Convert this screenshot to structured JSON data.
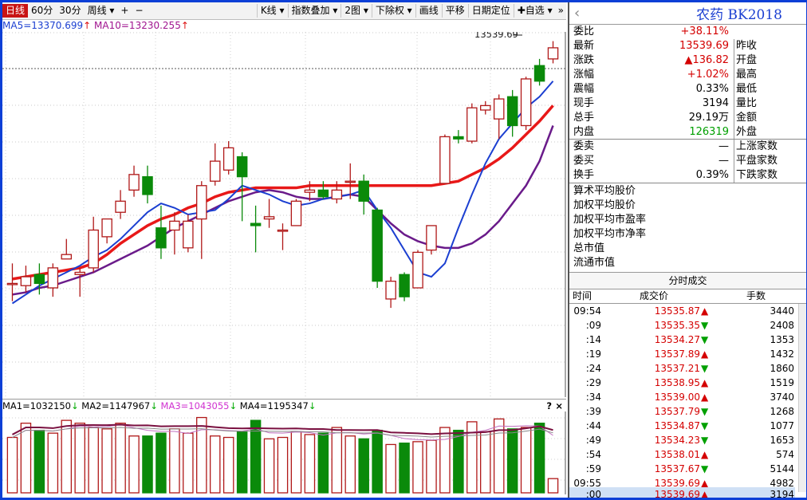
{
  "toolbar": {
    "items": [
      "日线",
      "60分",
      "30分",
      "周线 ▾",
      "+",
      "−",
      "K线 ▾",
      "指数叠加 ▾",
      "2图 ▾",
      "下除权 ▾",
      "画线",
      "平移",
      "日期定位",
      "✚自选 ▾"
    ],
    "active_index": 0,
    "right_icon": "»"
  },
  "ma": {
    "ma5": "MA5=13370.699",
    "ma10": "MA10=13230.255",
    "arrow_up": "↑",
    "colors": {
      "ma5": "#1b3fd1",
      "ma10": "#a0148f",
      "ma20": "#e81818",
      "ma60": "#6a1b8a",
      "up": "#b01818",
      "down": "#0a8a0a"
    }
  },
  "price_label": "13539.69",
  "chart_data": {
    "type": "candlestick",
    "ylim": [
      12080,
      13680
    ],
    "candles": [
      {
        "o": 12570,
        "c": 12570,
        "h": 12660,
        "l": 12490
      },
      {
        "o": 12560,
        "c": 12600,
        "h": 12650,
        "l": 12530
      },
      {
        "o": 12610,
        "c": 12570,
        "h": 12660,
        "l": 12520
      },
      {
        "o": 12550,
        "c": 12640,
        "h": 12660,
        "l": 12510
      },
      {
        "o": 12680,
        "c": 12700,
        "h": 12770,
        "l": 12680
      },
      {
        "o": 12610,
        "c": 12620,
        "h": 12640,
        "l": 12510
      },
      {
        "o": 12640,
        "c": 12810,
        "h": 12870,
        "l": 12620
      },
      {
        "o": 12780,
        "c": 12860,
        "h": 12860,
        "l": 12750
      },
      {
        "o": 12890,
        "c": 12940,
        "h": 12990,
        "l": 12860
      },
      {
        "o": 12990,
        "c": 13060,
        "h": 13100,
        "l": 12960
      },
      {
        "o": 13050,
        "c": 12970,
        "h": 13100,
        "l": 12930
      },
      {
        "o": 12820,
        "c": 12730,
        "h": 12920,
        "l": 12680
      },
      {
        "o": 12810,
        "c": 12850,
        "h": 12890,
        "l": 12700
      },
      {
        "o": 12730,
        "c": 12850,
        "h": 12880,
        "l": 12710
      },
      {
        "o": 12860,
        "c": 13010,
        "h": 13030,
        "l": 12680
      },
      {
        "o": 13030,
        "c": 13120,
        "h": 13200,
        "l": 13010
      },
      {
        "o": 13080,
        "c": 13180,
        "h": 13210,
        "l": 13060
      },
      {
        "o": 13140,
        "c": 13050,
        "h": 13160,
        "l": 12850
      },
      {
        "o": 12840,
        "c": 12830,
        "h": 12920,
        "l": 12710
      },
      {
        "o": 12860,
        "c": 12870,
        "h": 12950,
        "l": 12820
      },
      {
        "o": 12810,
        "c": 12810,
        "h": 12840,
        "l": 12720
      },
      {
        "o": 12830,
        "c": 12940,
        "h": 12950,
        "l": 12830
      },
      {
        "o": 12980,
        "c": 12990,
        "h": 13030,
        "l": 12940
      },
      {
        "o": 12990,
        "c": 12960,
        "h": 13030,
        "l": 12950
      },
      {
        "o": 12950,
        "c": 12990,
        "h": 13030,
        "l": 12930
      },
      {
        "o": 13030,
        "c": 13030,
        "h": 13110,
        "l": 12950
      },
      {
        "o": 13030,
        "c": 12940,
        "h": 13060,
        "l": 12880
      },
      {
        "o": 12900,
        "c": 12580,
        "h": 12910,
        "l": 12550
      },
      {
        "o": 12500,
        "c": 12580,
        "h": 12600,
        "l": 12460
      },
      {
        "o": 12610,
        "c": 12510,
        "h": 12620,
        "l": 12490
      },
      {
        "o": 12550,
        "c": 12710,
        "h": 12720,
        "l": 12550
      },
      {
        "o": 12720,
        "c": 12830,
        "h": 12830,
        "l": 12700
      },
      {
        "o": 13020,
        "c": 13230,
        "h": 13240,
        "l": 13020
      },
      {
        "o": 13230,
        "c": 13220,
        "h": 13260,
        "l": 13200
      },
      {
        "o": 13210,
        "c": 13360,
        "h": 13380,
        "l": 13200
      },
      {
        "o": 13350,
        "c": 13370,
        "h": 13390,
        "l": 13330
      },
      {
        "o": 13310,
        "c": 13400,
        "h": 13420,
        "l": 13220
      },
      {
        "o": 13410,
        "c": 13280,
        "h": 13440,
        "l": 13230
      },
      {
        "o": 13280,
        "c": 13490,
        "h": 13500,
        "l": 13260
      },
      {
        "o": 13550,
        "c": 13480,
        "h": 13580,
        "l": 13460
      },
      {
        "o": 13580,
        "c": 13630,
        "h": 13660,
        "l": 13560
      }
    ],
    "ma_fast": [
      12480,
      12520,
      12560,
      12590,
      12620,
      12650,
      12690,
      12720,
      12770,
      12830,
      12890,
      12930,
      12910,
      12880,
      12890,
      12900,
      12950,
      13010,
      12990,
      12970,
      12940,
      12920,
      12930,
      12950,
      12960,
      12970,
      12990,
      12900,
      12820,
      12720,
      12620,
      12600,
      12660,
      12820,
      12970,
      13110,
      13220,
      13290,
      13360,
      13410,
      13480
    ],
    "ma_mid": [
      12590,
      12600,
      12610,
      12620,
      12630,
      12640,
      12660,
      12700,
      12750,
      12790,
      12830,
      12860,
      12880,
      12910,
      12930,
      12960,
      12980,
      12990,
      13000,
      13000,
      13000,
      13000,
      13010,
      13010,
      13010,
      13010,
      13010,
      13010,
      13010,
      13010,
      13010,
      13010,
      13020,
      13030,
      13060,
      13090,
      13130,
      13180,
      13240,
      13300,
      13370
    ],
    "ma_slow": [
      12520,
      12530,
      12550,
      12560,
      12580,
      12600,
      12620,
      12650,
      12680,
      12710,
      12740,
      12780,
      12820,
      12850,
      12880,
      12910,
      12940,
      12960,
      12980,
      12990,
      12980,
      12960,
      12950,
      12950,
      12960,
      12970,
      12960,
      12900,
      12840,
      12790,
      12760,
      12740,
      12730,
      12730,
      12750,
      12790,
      12850,
      12930,
      13010,
      13120,
      13280
    ],
    "volume": [
      78,
      98,
      88,
      84,
      102,
      98,
      92,
      90,
      98,
      80,
      80,
      84,
      90,
      84,
      106,
      80,
      78,
      86,
      102,
      76,
      78,
      86,
      82,
      84,
      92,
      80,
      76,
      88,
      68,
      70,
      72,
      74,
      92,
      88,
      100,
      86,
      104,
      90,
      92,
      98,
      20
    ],
    "volume_ylim": [
      0,
      110
    ]
  },
  "vol_legend": {
    "ma1": "MA1=1032150",
    "ma2": "MA2=1147967",
    "ma3": "MA3=1043055",
    "ma4": "MA4=1195347",
    "arrow_down": "↓",
    "q": "?",
    "close": "×"
  },
  "stock": {
    "back_icon": "‹",
    "name": "农药 BK2018"
  },
  "quote": [
    {
      "label": "委比",
      "value": "+38.11%",
      "color": "red",
      "right": ""
    },
    {
      "label": "最新",
      "value": "13539.69",
      "color": "red",
      "right": "昨收"
    },
    {
      "label": "涨跌",
      "value": "▲136.82",
      "color": "red",
      "right": "开盘"
    },
    {
      "label": "涨幅",
      "value": "+1.02%",
      "color": "red",
      "right": "最高"
    },
    {
      "label": "震幅",
      "value": "0.33%",
      "color": "",
      "right": "最低"
    },
    {
      "label": "现手",
      "value": "3194",
      "color": "",
      "right": "量比"
    },
    {
      "label": "总手",
      "value": "29.19万",
      "color": "",
      "right": "金额"
    },
    {
      "label": "内盘",
      "value": "126319",
      "color": "green",
      "right": "外盘"
    },
    {
      "label": "委卖",
      "value": "—",
      "color": "",
      "right": "上涨家数"
    },
    {
      "label": "委买",
      "value": "—",
      "color": "",
      "right": "平盘家数"
    },
    {
      "label": "换手",
      "value": "0.39%",
      "color": "",
      "right": "下跌家数"
    }
  ],
  "averages": [
    "算术平均股价",
    "加权平均股价",
    "加权平均市盈率",
    "加权平均市净率",
    "总市值",
    "流通市值"
  ],
  "ticks_title": "分时成交",
  "ticks_header": {
    "time": "时间",
    "price": "成交价",
    "vol": "手数"
  },
  "ticks": [
    {
      "t": "09:54",
      "p": "13535.87",
      "d": "▲",
      "v": "3440"
    },
    {
      "t": ":09",
      "p": "13535.35",
      "d": "▼",
      "v": "2408"
    },
    {
      "t": ":14",
      "p": "13534.27",
      "d": "▼",
      "v": "1353"
    },
    {
      "t": ":19",
      "p": "13537.89",
      "d": "▲",
      "v": "1432"
    },
    {
      "t": ":24",
      "p": "13537.21",
      "d": "▼",
      "v": "1860"
    },
    {
      "t": ":29",
      "p": "13538.95",
      "d": "▲",
      "v": "1519"
    },
    {
      "t": ":34",
      "p": "13539.00",
      "d": "▲",
      "v": "3740"
    },
    {
      "t": ":39",
      "p": "13537.79",
      "d": "▼",
      "v": "1268"
    },
    {
      "t": ":44",
      "p": "13534.87",
      "d": "▼",
      "v": "1077"
    },
    {
      "t": ":49",
      "p": "13534.23",
      "d": "▼",
      "v": "1653"
    },
    {
      "t": ":54",
      "p": "13538.01",
      "d": "▲",
      "v": "574"
    },
    {
      "t": ":59",
      "p": "13537.67",
      "d": "▼",
      "v": "5144"
    },
    {
      "t": "09:55",
      "p": "13539.69",
      "d": "▲",
      "v": "4982"
    },
    {
      "t": ":00",
      "p": "13539.69",
      "d": "▲",
      "v": "3194"
    }
  ]
}
